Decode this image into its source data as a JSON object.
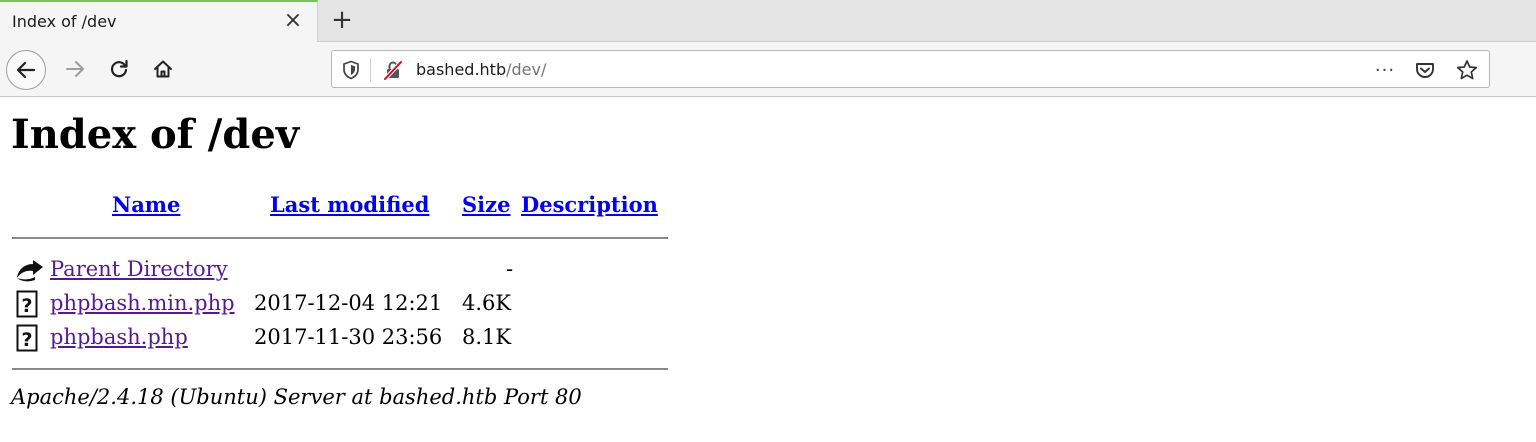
{
  "browser": {
    "tab": {
      "title": "Index of /dev",
      "close_glyph": "×"
    },
    "new_tab_glyph": "+",
    "url": {
      "host": "bashed.htb",
      "path": "/dev/"
    },
    "more_glyph": "···"
  },
  "page": {
    "title": "Index of /dev",
    "columns": {
      "name": "Name",
      "last_modified": "Last modified",
      "size": "Size",
      "description": "Description"
    },
    "rows": [
      {
        "icon": "back-icon",
        "name": "Parent Directory",
        "last_modified": "",
        "size": "-",
        "description": ""
      },
      {
        "icon": "unknown-file-icon",
        "name": "phpbash.min.php",
        "last_modified": "2017-12-04 12:21",
        "size": "4.6K",
        "description": ""
      },
      {
        "icon": "unknown-file-icon",
        "name": "phpbash.php",
        "last_modified": "2017-11-30 23:56",
        "size": "8.1K",
        "description": ""
      }
    ],
    "address": "Apache/2.4.18 (Ubuntu) Server at bashed.htb Port 80"
  },
  "colors": {
    "link": "#0000ee",
    "visited_link": "#551a8b",
    "tab_accent": "#77c15a"
  }
}
